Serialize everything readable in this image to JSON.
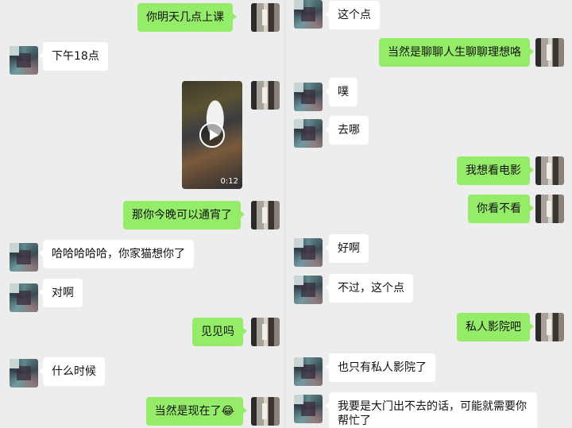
{
  "left_chat": {
    "messages": [
      {
        "from": "me",
        "text": "你明天几点上课"
      },
      {
        "from": "friend",
        "text": "下午18点"
      },
      {
        "from": "me",
        "type": "video",
        "duration": "0:12"
      },
      {
        "from": "me",
        "text": "那你今晚可以通宵了"
      },
      {
        "from": "friend",
        "text": "哈哈哈哈哈，你家猫想你了"
      },
      {
        "from": "friend",
        "text": "对啊"
      },
      {
        "from": "me",
        "text": "见见吗"
      },
      {
        "from": "friend",
        "text": "什么时候"
      },
      {
        "from": "me",
        "text": "当然是现在了",
        "emoji": "😂"
      }
    ]
  },
  "right_chat": {
    "messages": [
      {
        "from": "friend",
        "text": "这个点"
      },
      {
        "from": "me",
        "text": "当然是聊聊人生聊聊理想咯"
      },
      {
        "from": "friend",
        "text": "噗"
      },
      {
        "from": "friend",
        "text": "去哪"
      },
      {
        "from": "me",
        "text": "我想看电影"
      },
      {
        "from": "me",
        "text": "你看不看"
      },
      {
        "from": "friend",
        "text": "好啊"
      },
      {
        "from": "friend",
        "text": "不过，这个点"
      },
      {
        "from": "me",
        "text": "私人影院吧"
      },
      {
        "from": "friend",
        "text": "也只有私人影院了"
      },
      {
        "from": "friend",
        "text": "我要是大门出不去的话，可能就需要你帮忙了"
      }
    ]
  },
  "colors": {
    "background": "#ededed",
    "incoming_bubble": "#ffffff",
    "outgoing_bubble": "#95ec69"
  }
}
